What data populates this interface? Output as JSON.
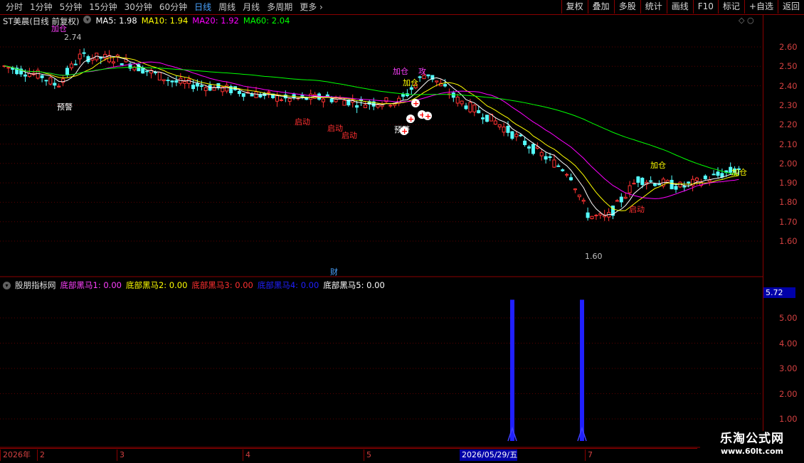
{
  "toolbar": {
    "periods": [
      "分时",
      "1分钟",
      "5分钟",
      "15分钟",
      "30分钟",
      "60分钟",
      "日线",
      "周线",
      "月线",
      "多周期",
      "更多"
    ],
    "active_period": "日线",
    "right_tools": [
      "复权",
      "叠加",
      "多股",
      "统计",
      "画线",
      "F10",
      "标记",
      "+自选",
      "返回"
    ]
  },
  "stock": {
    "title": "ST美晨(日线 前复权)",
    "ma": [
      {
        "label": "MA5: 1.98",
        "color": "#ffffff"
      },
      {
        "label": "MA10: 1.94",
        "color": "#ffff00"
      },
      {
        "label": "MA20: 1.92",
        "color": "#ff00ff"
      },
      {
        "label": "MA60: 2.04",
        "color": "#00ff00"
      }
    ]
  },
  "indicator": {
    "name": "股朋指标网",
    "items": [
      {
        "label": "底部黑马1: 0.00",
        "color": "#ff40ff"
      },
      {
        "label": "底部黑马2: 0.00",
        "color": "#ffff00"
      },
      {
        "label": "底部黑马3: 0.00",
        "color": "#ff3030"
      },
      {
        "label": "底部黑马4: 0.00",
        "color": "#2020ff"
      },
      {
        "label": "底部黑马5: 0.00",
        "color": "#ffffff"
      }
    ],
    "current_value": "5.72",
    "axis": [
      "5.00",
      "4.00",
      "3.00",
      "2.00",
      "1.00"
    ]
  },
  "price_axis": [
    "2.60",
    "2.50",
    "2.40",
    "2.30",
    "2.20",
    "2.10",
    "2.00",
    "1.90",
    "1.80",
    "1.70",
    "1.60"
  ],
  "annotations": {
    "high_label": "2.74",
    "low_label": "1.60",
    "signal_jiacang": "加仓",
    "signal_qidong": "启动",
    "signal_yujing": "预警",
    "signal_gong": "攻",
    "finance_mark": "财"
  },
  "dates": {
    "year": "2026年",
    "months": [
      "2",
      "3",
      "4",
      "5",
      "7"
    ],
    "cursor_date": "2026/05/29/五"
  },
  "watermark": {
    "title": "乐淘公式网",
    "url": "www.60lt.com"
  },
  "chart_data": {
    "type": "bar",
    "title": "",
    "series": [
      {
        "name": "底部黑马4",
        "values": [
          5.72,
          5.72
        ]
      }
    ],
    "price_range": [
      1.6,
      2.74
    ],
    "indicator_ylim": [
      0,
      5.72
    ]
  }
}
